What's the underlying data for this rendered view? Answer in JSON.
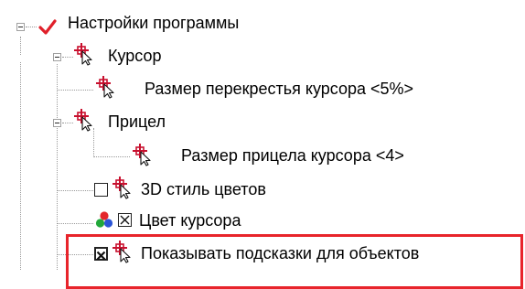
{
  "tree": {
    "root": {
      "label": "Настройки программы",
      "icon": "red-checkmark-icon",
      "expanded": true
    },
    "cursor": {
      "label": "Курсор",
      "icon": "cursor-crosshair-icon",
      "expanded": true
    },
    "crosshair_size": {
      "label": "Размер перекрестья курсора <5%>",
      "icon": "cursor-crosshair-icon"
    },
    "aim": {
      "label": "Прицел",
      "icon": "cursor-crosshair-icon",
      "expanded": true
    },
    "aim_size": {
      "label": "Размер прицела курсора <4>",
      "icon": "cursor-crosshair-icon"
    },
    "style_3d": {
      "label": "3D стиль цветов",
      "icon": "cursor-crosshair-icon",
      "checked": false
    },
    "cursor_color": {
      "label": "Цвет курсора",
      "icon": "rgb-circles-icon",
      "checked": true
    },
    "show_hints": {
      "label": "Показывать подсказки для объектов",
      "icon": "cursor-crosshair-icon",
      "checked": true
    }
  },
  "colors": {
    "highlight_border": "#e8242b",
    "icon_red": "#c8102e",
    "checkmark_red": "#e0202a"
  }
}
